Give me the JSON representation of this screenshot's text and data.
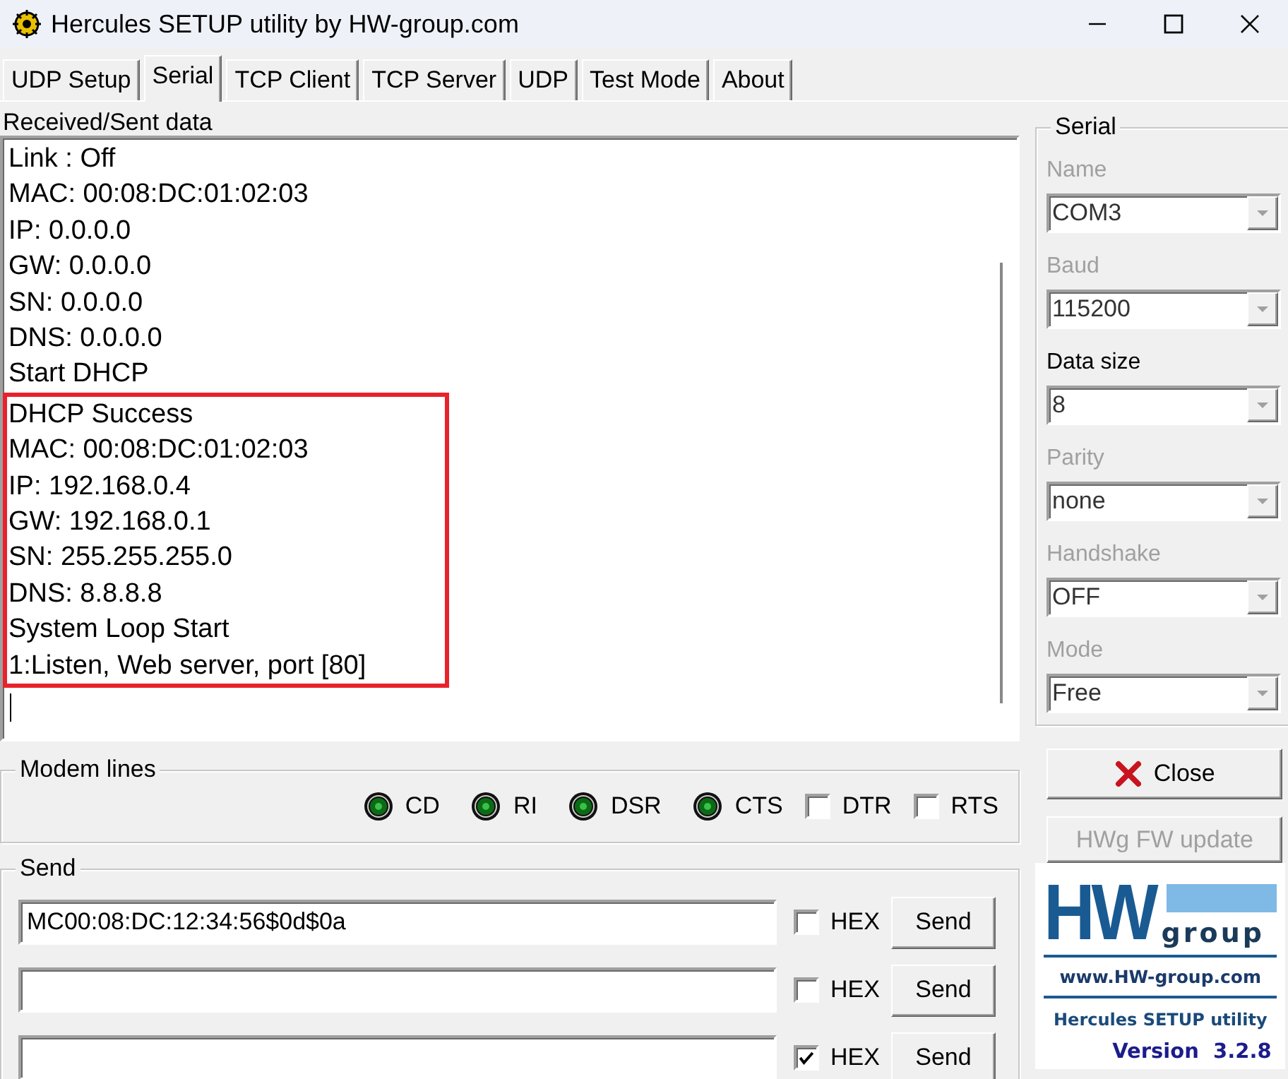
{
  "window": {
    "title": "Hercules SETUP utility by HW-group.com"
  },
  "tabs": [
    {
      "label": "UDP Setup",
      "selected": false
    },
    {
      "label": "Serial",
      "selected": true
    },
    {
      "label": "TCP Client",
      "selected": false
    },
    {
      "label": "TCP Server",
      "selected": false
    },
    {
      "label": "UDP",
      "selected": false
    },
    {
      "label": "Test Mode",
      "selected": false
    },
    {
      "label": "About",
      "selected": false
    }
  ],
  "log": {
    "label": "Received/Sent data",
    "blocks": [
      {
        "highlighted": false,
        "lines": [
          "Link : Off",
          "MAC: 00:08:DC:01:02:03",
          "IP: 0.0.0.0",
          "GW: 0.0.0.0",
          "SN: 0.0.0.0",
          "DNS: 0.0.0.0",
          "Start DHCP"
        ]
      },
      {
        "highlighted": true,
        "lines": [
          "DHCP Success",
          "MAC: 00:08:DC:01:02:03",
          "IP: 192.168.0.4",
          "GW: 192.168.0.1",
          "SN: 255.255.255.0",
          "DNS: 8.8.8.8",
          "System Loop Start",
          "1:Listen, Web server, port [80]"
        ]
      }
    ]
  },
  "serial": {
    "title": "Serial",
    "fields": [
      {
        "label": "Name",
        "value": "COM3",
        "disabled": true
      },
      {
        "label": "Baud",
        "value": "115200",
        "disabled": true
      },
      {
        "label": "Data size",
        "value": "8",
        "disabled": false
      },
      {
        "label": "Parity",
        "value": "none",
        "disabled": true
      },
      {
        "label": "Handshake",
        "value": "OFF",
        "disabled": true
      },
      {
        "label": "Mode",
        "value": "Free",
        "disabled": true
      }
    ]
  },
  "modem_lines": {
    "title": "Modem lines",
    "items": [
      {
        "kind": "led",
        "label": "CD",
        "on": true
      },
      {
        "kind": "led",
        "label": "RI",
        "on": true
      },
      {
        "kind": "led",
        "label": "DSR",
        "on": true
      },
      {
        "kind": "led",
        "label": "CTS",
        "on": true
      },
      {
        "kind": "checkbox",
        "label": "DTR",
        "checked": false
      },
      {
        "kind": "checkbox",
        "label": "RTS",
        "checked": false
      }
    ]
  },
  "send": {
    "title": "Send",
    "rows": [
      {
        "value": "MC00:08:DC:12:34:56$0d$0a",
        "hex_label": "HEX",
        "hex_checked": false,
        "button": "Send"
      },
      {
        "hex_label": "HEX",
        "hex_checked": false,
        "button": "Send"
      },
      {
        "hex_label": "HEX",
        "hex_checked": true,
        "button": "Send"
      }
    ]
  },
  "buttons": [
    {
      "kind": "close",
      "label": "Close",
      "disabled": false
    },
    {
      "kind": "plain",
      "label": "HWg FW update",
      "disabled": true
    }
  ],
  "logo": {
    "mark": "HW",
    "word": "group",
    "url": "www.HW-group.com",
    "product": "Hercules SETUP utility",
    "version": "Version  3.2.8"
  }
}
